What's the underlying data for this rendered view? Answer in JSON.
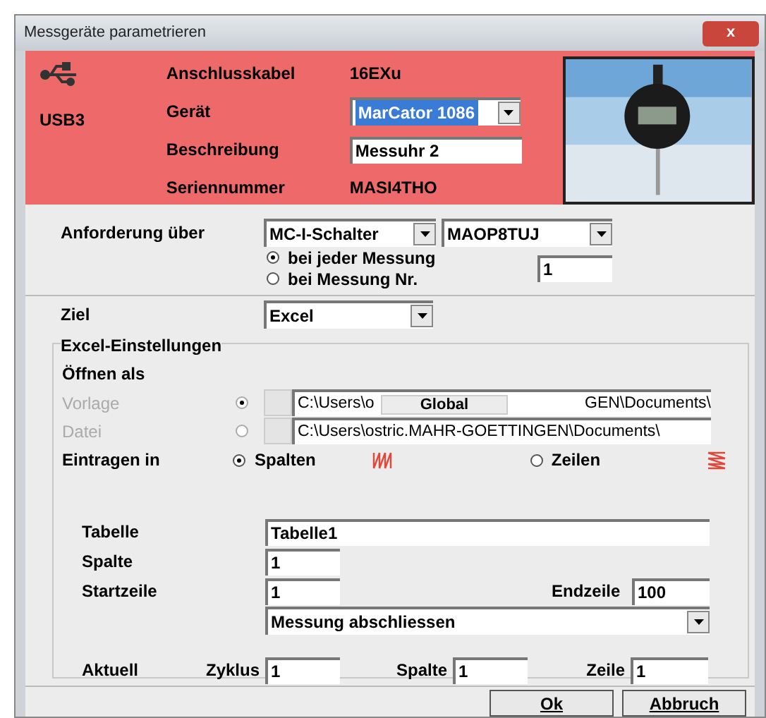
{
  "window": {
    "title": "Messgeräte parametrieren",
    "close": "x"
  },
  "device": {
    "port": "USB3",
    "rows": [
      {
        "kind": "text",
        "label": "Anschlusskabel",
        "value": "16EXu"
      },
      {
        "kind": "select",
        "label": "Gerät",
        "value": "MarCator 1086",
        "selected": true
      },
      {
        "kind": "input",
        "label": "Beschreibung",
        "value": "Messuhr 2"
      },
      {
        "kind": "text",
        "label": "Seriennummer",
        "value": "MASI4THO"
      }
    ]
  },
  "request": {
    "label": "Anforderung über",
    "selects": [
      "MC-I-Schalter",
      "MAOP8TUJ"
    ],
    "options": [
      {
        "label": "bei jeder Messung",
        "selected": true
      },
      {
        "label": "bei Messung Nr.",
        "selected": false
      }
    ],
    "number": "1"
  },
  "target": {
    "label": "Ziel",
    "value": "Excel"
  },
  "excel": {
    "title": "Excel-Einstellungen",
    "open_as": "Öffnen als",
    "files": [
      {
        "label": "Vorlage",
        "selected": true,
        "disabled": true,
        "path_start": "C:\\Users\\o",
        "path_end": "GEN\\Documents\\"
      },
      {
        "label": "Datei",
        "selected": false,
        "disabled": true,
        "path_start": "C:\\Users\\ostric.MAHR-GOETTINGEN\\Documents\\"
      }
    ],
    "popup": "Global",
    "enter_in": {
      "label": "Eintragen in",
      "options": [
        {
          "label": "Spalten",
          "selected": true
        },
        {
          "label": "Zeilen",
          "selected": false
        }
      ]
    },
    "sheet": {
      "label": "Tabelle",
      "value": "Tabelle1"
    },
    "column": {
      "label": "Spalte",
      "value": "1"
    },
    "start_row": {
      "label": "Startzeile",
      "value": "1"
    },
    "end_row": {
      "label": "Endzeile",
      "value": "100"
    },
    "action": "Messung abschliessen",
    "current": {
      "label": "Aktuell",
      "fields": [
        {
          "label": "Zyklus",
          "value": "1"
        },
        {
          "label": "Spalte",
          "value": "1"
        },
        {
          "label": "Zeile",
          "value": "1"
        }
      ]
    }
  },
  "buttons": [
    "Ok",
    "Abbruch"
  ]
}
